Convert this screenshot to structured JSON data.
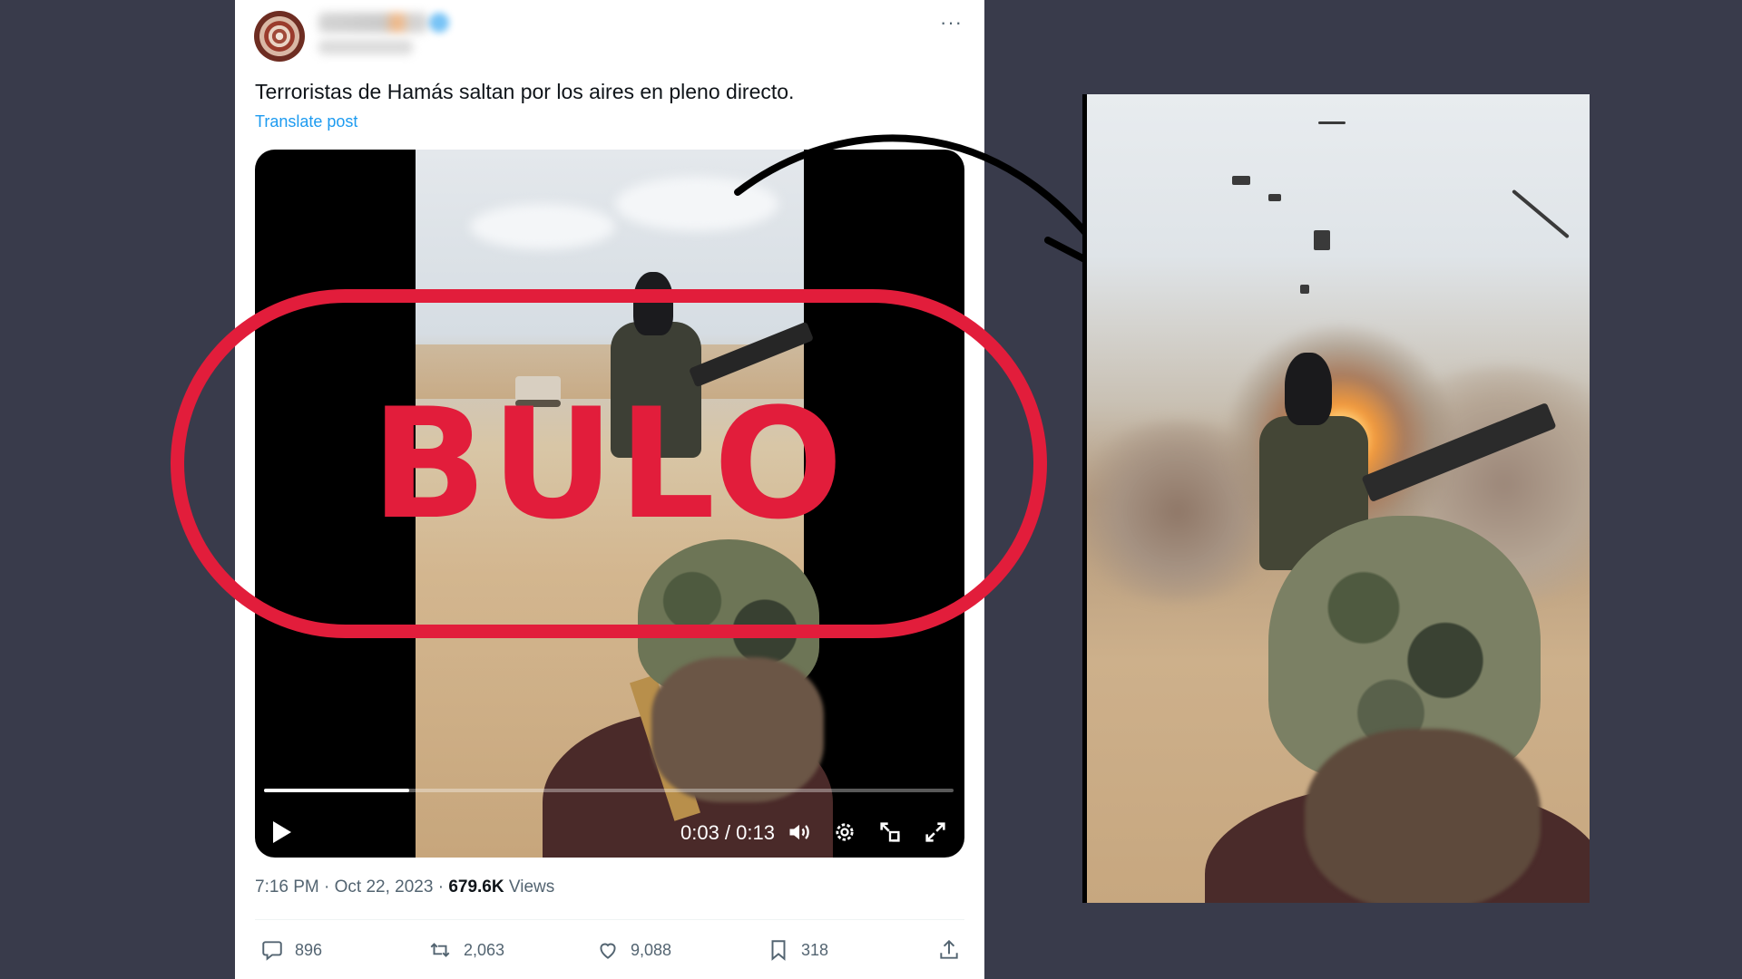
{
  "tweet": {
    "text": "Terroristas de Hamás saltan por los aires en pleno directo.",
    "translate_label": "Translate post",
    "more_label": "···",
    "timestamp": "7:16 PM · Oct 22, 2023 · ",
    "views_count": "679.6K",
    "views_label": " Views"
  },
  "video": {
    "time": "0:03 / 0:13",
    "progress": 0.21
  },
  "actions": [
    {
      "icon": "reply-icon",
      "count": "896"
    },
    {
      "icon": "retweet-icon",
      "count": "2,063"
    },
    {
      "icon": "like-icon",
      "count": "9,088"
    },
    {
      "icon": "bookmark-icon",
      "count": "318"
    },
    {
      "icon": "share-icon",
      "count": ""
    }
  ],
  "overlay": {
    "stamp_text": "BULO",
    "stamp_color": "#e21d3b"
  },
  "colors": {
    "background": "#393b4b",
    "link": "#1d9bf0",
    "muted": "#536471"
  }
}
